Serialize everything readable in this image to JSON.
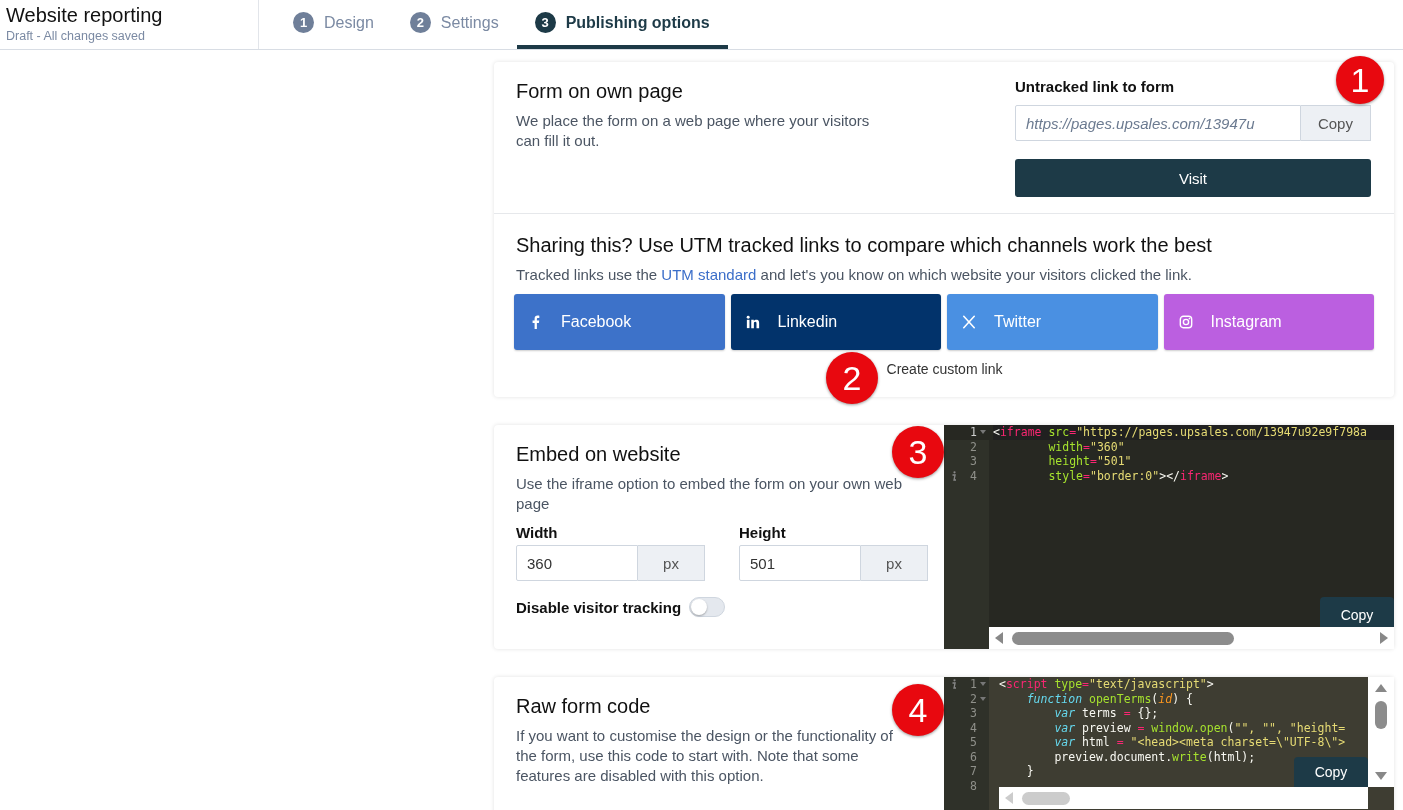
{
  "header": {
    "title": "Website reporting",
    "subtitle": "Draft - All changes saved"
  },
  "tabs": [
    {
      "number": "1",
      "label": "Design",
      "selected": false
    },
    {
      "number": "2",
      "label": "Settings",
      "selected": false
    },
    {
      "number": "3",
      "label": "Publishing options",
      "selected": true
    }
  ],
  "own_page": {
    "title": "Form on own page",
    "description": "We place the form on a web page where your visitors can fill it out.",
    "link_label": "Untracked link to form",
    "link_placeholder": "https://pages.upsales.com/13947u",
    "copy_button": "Copy",
    "visit_button": "Visit"
  },
  "sharing": {
    "title": "Sharing this? Use UTM tracked links to compare which channels work the best",
    "description_before": "Tracked links use the",
    "description_link": "UTM standard",
    "description_after": "and let's you know on which website your visitors clicked the link.",
    "channels": [
      {
        "kind": "facebook",
        "label": "Facebook",
        "color": "#3d72c9"
      },
      {
        "kind": "linkedin",
        "label": "Linkedin",
        "color": "#02336b"
      },
      {
        "kind": "x",
        "label": "Twitter",
        "color": "#4a90e2"
      },
      {
        "kind": "instagram",
        "label": "Instagram",
        "color": "#bb5fe0"
      }
    ],
    "custom_link": "Create custom link"
  },
  "embed": {
    "title": "Embed on website",
    "description": "Use the iframe option to embed the form on your own web page",
    "width_label": "Width",
    "width_value": "360",
    "width_unit": "px",
    "height_label": "Height",
    "height_value": "501",
    "height_unit": "px",
    "tracking_label": "Disable visitor tracking",
    "tracking_on": false,
    "code": {
      "copy_button": "Copy",
      "lines": [
        {
          "number": "1",
          "fold": true,
          "info": false,
          "tokens": [
            {
              "t": "<"
            },
            {
              "t": "iframe",
              "color": "#f92672"
            },
            {
              "t": " src",
              "color": "#a6e22e"
            },
            {
              "t": "=",
              "color": "#f92672"
            },
            {
              "t": "\"https://pages.upsales.com/13947u92e9f798a",
              "color": "#e6db74"
            }
          ]
        },
        {
          "number": "2",
          "fold": false,
          "info": false,
          "tokens": [
            {
              "t": "        width",
              "color": "#a6e22e"
            },
            {
              "t": "=",
              "color": "#f92672"
            },
            {
              "t": "\"360\"",
              "color": "#e6db74"
            }
          ]
        },
        {
          "number": "3",
          "fold": false,
          "info": false,
          "tokens": [
            {
              "t": "        height",
              "color": "#a6e22e"
            },
            {
              "t": "=",
              "color": "#f92672"
            },
            {
              "t": "\"501\"",
              "color": "#e6db74"
            }
          ]
        },
        {
          "number": "4",
          "fold": false,
          "info": true,
          "tokens": [
            {
              "t": "        style",
              "color": "#a6e22e"
            },
            {
              "t": "=",
              "color": "#f92672"
            },
            {
              "t": "\"border:0\"",
              "color": "#e6db74"
            },
            {
              "t": "></"
            },
            {
              "t": "iframe",
              "color": "#f92672"
            },
            {
              "t": ">"
            }
          ]
        }
      ]
    }
  },
  "raw": {
    "title": "Raw form code",
    "description": "If you want to customise the design or the functionality of the form, use this code to start with. Note that some features are disabled with this option.",
    "code": {
      "copy_button": "Copy",
      "lines": [
        {
          "number": "1",
          "fold": true,
          "info": true,
          "tokens": [
            {
              "t": "<"
            },
            {
              "t": "script",
              "color": "#f92672"
            },
            {
              "t": " type",
              "color": "#a6e22e"
            },
            {
              "t": "=",
              "color": "#f92672"
            },
            {
              "t": "\"text/javascript\"",
              "color": "#e6db74"
            },
            {
              "t": ">"
            }
          ]
        },
        {
          "number": "2",
          "fold": true,
          "info": false,
          "tokens": [
            {
              "t": "    function",
              "color": "#66d9ef"
            },
            {
              "t": " openTerms",
              "color": "#a6e22e"
            },
            {
              "t": "("
            },
            {
              "t": "id",
              "color": "#fd971f"
            },
            {
              "t": ") {"
            }
          ]
        },
        {
          "number": "3",
          "fold": false,
          "info": false,
          "tokens": [
            {
              "t": "        var",
              "color": "#66d9ef"
            },
            {
              "t": " terms ",
              "color": "#f8f8f2"
            },
            {
              "t": "=",
              "color": "#f92672"
            },
            {
              "t": " {};",
              "color": "#f8f8f2"
            }
          ]
        },
        {
          "number": "4",
          "fold": false,
          "info": false,
          "tokens": [
            {
              "t": "        var",
              "color": "#66d9ef"
            },
            {
              "t": " preview ",
              "color": "#f8f8f2"
            },
            {
              "t": "=",
              "color": "#f92672"
            },
            {
              "t": " window.open",
              "color": "#a6e22e"
            },
            {
              "t": "("
            },
            {
              "t": "\"\", \"\", \"height=",
              "color": "#e6db74"
            }
          ]
        },
        {
          "number": "5",
          "fold": false,
          "info": false,
          "tokens": [
            {
              "t": "        var",
              "color": "#66d9ef"
            },
            {
              "t": " html ",
              "color": "#f8f8f2"
            },
            {
              "t": "=",
              "color": "#f92672"
            },
            {
              "t": " \"<head><meta charset=\\\"UTF-8\\\">",
              "color": "#e6db74"
            }
          ]
        },
        {
          "number": "6",
          "fold": false,
          "info": false,
          "tokens": [
            {
              "t": "        preview.document.",
              "color": "#f8f8f2"
            },
            {
              "t": "write",
              "color": "#a6e22e"
            },
            {
              "t": "(html);",
              "color": "#f8f8f2"
            }
          ]
        },
        {
          "number": "7",
          "fold": false,
          "info": false,
          "tokens": [
            {
              "t": "    }",
              "color": "#f8f8f2"
            }
          ]
        },
        {
          "number": "8",
          "fold": false,
          "info": false
        }
      ]
    }
  },
  "callouts": [
    "1",
    "2",
    "3",
    "4"
  ]
}
